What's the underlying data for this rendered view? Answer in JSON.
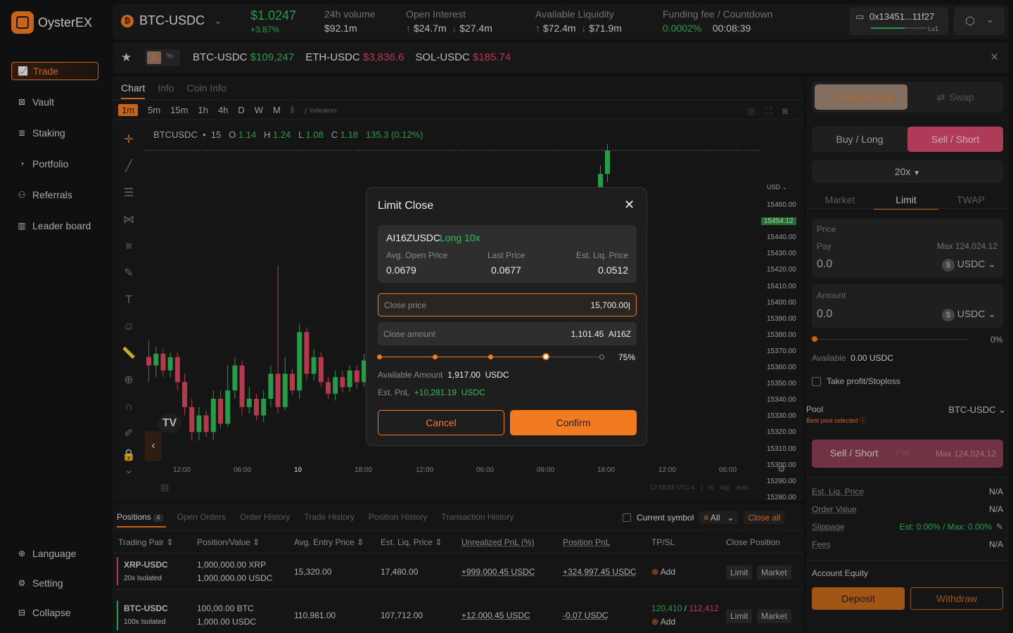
{
  "app": {
    "name": "OysterEX"
  },
  "sidebar": {
    "items": [
      {
        "label": "Trade",
        "icon": "chart-line-icon"
      },
      {
        "label": "Vault",
        "icon": "vault-icon"
      },
      {
        "label": "Staking",
        "icon": "staking-icon"
      },
      {
        "label": "Portfolio",
        "icon": "portfolio-icon"
      },
      {
        "label": "Referrals",
        "icon": "referrals-icon"
      },
      {
        "label": "Leader board",
        "icon": "leaderboard-icon"
      }
    ],
    "footer": [
      {
        "label": "Language",
        "icon": "globe-icon"
      },
      {
        "label": "Setting",
        "icon": "gear-icon"
      },
      {
        "label": "Collapse",
        "icon": "collapse-icon"
      }
    ]
  },
  "topbar": {
    "pair": "BTC-USDC",
    "coin_glyph": "₿",
    "price": "$1.0247",
    "change": "+3.87%",
    "volume_label": "24h volume",
    "volume": "$92.1m",
    "oi_label": "Open Interest",
    "oi_long": "$24.7m",
    "oi_short": "$27.4m",
    "liq_label": "Available Liquidity",
    "liq_long": "$72.4m",
    "liq_short": "$71.9m",
    "funding_label": "Funding fee / Countdown",
    "funding": "0.0002%",
    "countdown": "00:08:39",
    "wallet": "0x13451...11f27",
    "level": "Lv1"
  },
  "ticker": {
    "toggle_dollar": "$",
    "toggle_pct": "%",
    "items": [
      {
        "pair": "BTC-USDC",
        "price": "$109,247",
        "color": "green"
      },
      {
        "pair": "ETH-USDC",
        "price": "$3,836.6",
        "color": "red"
      },
      {
        "pair": "SOL-USDC",
        "price": "$185.74",
        "color": "red"
      }
    ]
  },
  "chart": {
    "tabs": [
      "Chart",
      "Info",
      "Coin Info"
    ],
    "intervals": [
      "1m",
      "5m",
      "15m",
      "1h",
      "4h",
      "D",
      "W",
      "M"
    ],
    "indicators_label": "Indicators",
    "symbol": "BTCUSDC",
    "symbol_tf": "15",
    "o": "1.14",
    "h": "1.24",
    "l": "1.08",
    "c": "1.18",
    "chg": "135.3 (0.12%)",
    "currency": "USD",
    "yticks": [
      "15460.00",
      "15454.12",
      "15440.00",
      "15430.00",
      "15420.00",
      "15410.00",
      "15400.00",
      "15390.00",
      "15380.00",
      "15370.00",
      "15360.00",
      "15350.00",
      "15340.00",
      "15330.00",
      "15320.00",
      "15310.00",
      "15300.00",
      "15290.00",
      "15280.00"
    ],
    "xticks": [
      "12:00",
      "06:00",
      "10",
      "18:00",
      "12:00",
      "06:00",
      "09:00",
      "18:00",
      "12:00",
      "06:00"
    ],
    "time": "12:58:58 UTC-4",
    "scale_opts": [
      "%",
      "log",
      "auto"
    ]
  },
  "chart_data": {
    "type": "candlestick",
    "symbol": "BTCUSDC",
    "last_price": 15454.12,
    "ylim": [
      15275,
      15465
    ],
    "candles": [
      {
        "o": 15330,
        "c": 15325,
        "h": 15340,
        "l": 15315
      },
      {
        "o": 15325,
        "c": 15332,
        "h": 15336,
        "l": 15318
      },
      {
        "o": 15332,
        "c": 15322,
        "h": 15335,
        "l": 15318
      },
      {
        "o": 15322,
        "c": 15330,
        "h": 15333,
        "l": 15318
      },
      {
        "o": 15330,
        "c": 15315,
        "h": 15333,
        "l": 15310
      },
      {
        "o": 15315,
        "c": 15300,
        "h": 15320,
        "l": 15295
      },
      {
        "o": 15300,
        "c": 15285,
        "h": 15305,
        "l": 15280
      },
      {
        "o": 15285,
        "c": 15295,
        "h": 15300,
        "l": 15280
      },
      {
        "o": 15295,
        "c": 15285,
        "h": 15298,
        "l": 15282
      },
      {
        "o": 15285,
        "c": 15305,
        "h": 15310,
        "l": 15280
      },
      {
        "o": 15305,
        "c": 15290,
        "h": 15310,
        "l": 15287
      },
      {
        "o": 15290,
        "c": 15310,
        "h": 15325,
        "l": 15288
      },
      {
        "o": 15310,
        "c": 15325,
        "h": 15330,
        "l": 15305
      },
      {
        "o": 15325,
        "c": 15300,
        "h": 15328,
        "l": 15295
      },
      {
        "o": 15300,
        "c": 15305,
        "h": 15312,
        "l": 15296
      },
      {
        "o": 15305,
        "c": 15295,
        "h": 15308,
        "l": 15292
      },
      {
        "o": 15295,
        "c": 15305,
        "h": 15310,
        "l": 15291
      },
      {
        "o": 15305,
        "c": 15320,
        "h": 15325,
        "l": 15300
      },
      {
        "o": 15320,
        "c": 15300,
        "h": 15385,
        "l": 15296
      },
      {
        "o": 15300,
        "c": 15320,
        "h": 15330,
        "l": 15298
      },
      {
        "o": 15320,
        "c": 15310,
        "h": 15323,
        "l": 15307
      },
      {
        "o": 15310,
        "c": 15345,
        "h": 15350,
        "l": 15305
      },
      {
        "o": 15345,
        "c": 15320,
        "h": 15348,
        "l": 15316
      },
      {
        "o": 15320,
        "c": 15330,
        "h": 15335,
        "l": 15316
      },
      {
        "o": 15330,
        "c": 15315,
        "h": 15333,
        "l": 15312
      },
      {
        "o": 15315,
        "c": 15308,
        "h": 15318,
        "l": 15305
      },
      {
        "o": 15308,
        "c": 15318,
        "h": 15322,
        "l": 15304
      },
      {
        "o": 15318,
        "c": 15312,
        "h": 15322,
        "l": 15309
      },
      {
        "o": 15312,
        "c": 15322,
        "h": 15325,
        "l": 15309
      },
      {
        "o": 15322,
        "c": 15315,
        "h": 15325,
        "l": 15311
      },
      {
        "o": 15315,
        "c": 15328,
        "h": 15332,
        "l": 15312
      },
      {
        "o": 15328,
        "c": 15370,
        "h": 15380,
        "l": 15322
      },
      {
        "o": 15370,
        "c": 15440,
        "h": 15445,
        "l": 15365
      },
      {
        "o": 15440,
        "c": 15454,
        "h": 15458,
        "l": 15435
      }
    ]
  },
  "modal": {
    "title": "Limit Close",
    "pair": "AI16ZUSDC",
    "position": "Long 10x",
    "avg_open_label": "Avg. Open Price",
    "avg_open": "0.0679",
    "last_label": "Last Price",
    "last": "0.0677",
    "liq_label": "Est. Liq. Price",
    "liq": "0.0512",
    "close_price_label": "Close price",
    "close_price": "15,700.00|",
    "close_amount_label": "Close amount",
    "close_amount": "1,101.45",
    "close_amount_unit": "AI16Z",
    "slider_pct": "75%",
    "slider_value": 0.75,
    "available_label": "Available Amount",
    "available": "1,917.00",
    "available_unit": "USDC",
    "pnl_label": "Est. PnL",
    "pnl": "+10,281.19",
    "pnl_unit": "USDC",
    "cancel": "Cancel",
    "confirm": "Confirm"
  },
  "right": {
    "tab_perp": "Perp Future",
    "tab_swap": "Swap",
    "buy": "Buy / Long",
    "sell": "Sell / Short",
    "leverage": "20x",
    "order_types": [
      "Market",
      "Limit",
      "TWAP"
    ],
    "price_label": "Price",
    "pay_label": "Pay",
    "max_label": "Max 124,024.12",
    "price_value": "0.0",
    "unit": "USDC",
    "amount_label": "Amount",
    "amount_value": "0.0",
    "slider_pct": "0%",
    "slider_value": 0,
    "available_label": "Available",
    "available": "0.00",
    "available_unit": "USDC",
    "tpsl": "Take profit/Stoploss",
    "pool_label": "Pool",
    "pool_value": "BTC-USDC",
    "pool_hint": "Best pool selected",
    "submit": "Sell / Short",
    "submit_pay": "Pay",
    "submit_max": "Max 124,024.12",
    "details": [
      {
        "label": "Est. Liq. Price",
        "value": "N/A"
      },
      {
        "label": "Order Value",
        "value": "N/A"
      },
      {
        "label": "Slippage",
        "value": "Est: 0.00% / Max: 0.00%"
      },
      {
        "label": "Fees",
        "value": "N/A"
      }
    ],
    "equity_label": "Account Equity",
    "deposit": "Deposit",
    "withdraw": "Withdraw"
  },
  "bottom": {
    "tabs": [
      "Positions",
      "Open Orders",
      "Order History",
      "Trade History",
      "Position History",
      "Transaction History"
    ],
    "positions_count": "4",
    "current_symbol": "Current symbol",
    "filter": "All",
    "close_all": "Close all",
    "headers": [
      "Trading Pair",
      "Position/Value",
      "Avg. Entry Price",
      "Est. Liq. Price",
      "Unrealized PnL (%)",
      "Position PnL",
      "TP/SL",
      "Close Position"
    ],
    "rows": [
      {
        "pair": "XRP-USDC",
        "mode": "20x Isolated",
        "size": "1,000,000.00 XRP",
        "value": "1,000,000.00 USDC",
        "entry": "15,320.00",
        "liq": "17,480.00",
        "upnl": "+999,000.45 USDC",
        "ppnl": "+324,997.45 USDC",
        "tpsl": "Add",
        "tpsl_values": "",
        "limit": "Limit",
        "market": "Market",
        "side": "red"
      },
      {
        "pair": "BTC-USDC",
        "mode": "100x Isolated",
        "size": "100,00.00 BTC",
        "value": "1,000.00 USDC",
        "entry": "110,981.00",
        "liq": "107,712.00",
        "upnl": "+12,000.45 USDC",
        "ppnl": "-0.07 USDC",
        "tpsl": "Add",
        "tp": "120,410",
        "sl": "112,412",
        "limit": "Limit",
        "market": "Market",
        "side": "green"
      }
    ]
  },
  "colors": {
    "accent": "#f27b1f",
    "green": "#2fbf5a",
    "red": "#e0445e",
    "sell": "#d6486d"
  }
}
